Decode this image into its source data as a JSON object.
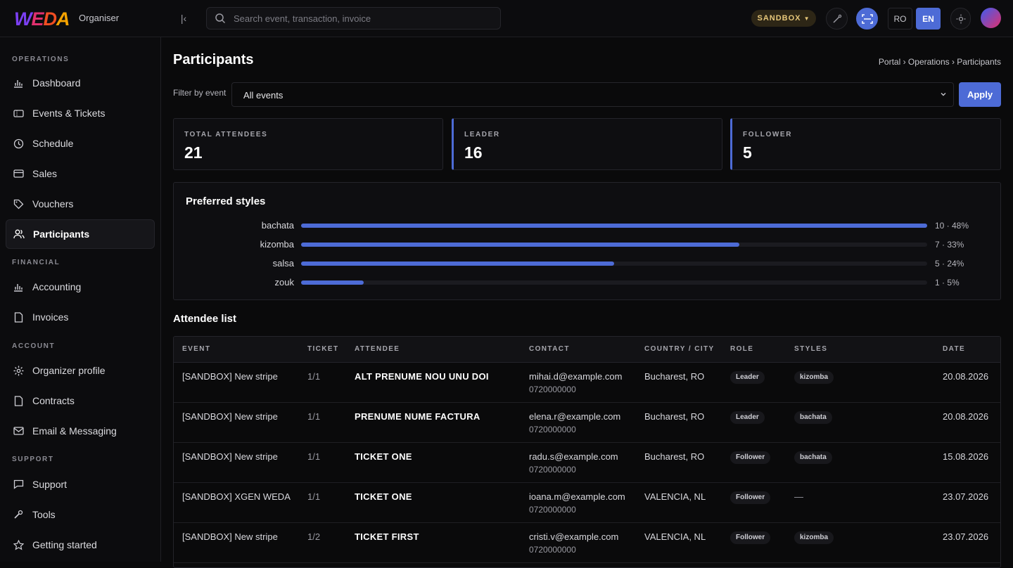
{
  "header": {
    "logo": [
      "W",
      "E",
      "D",
      "A"
    ],
    "org_label": "Organiser",
    "search_placeholder": "Search event, transaction, invoice",
    "sandbox_label": "SANDBOX",
    "lang_ro": "RO",
    "lang_en": "EN"
  },
  "sidebar": {
    "sections": [
      {
        "title": "OPERATIONS",
        "items": [
          {
            "label": "Dashboard",
            "icon": "chart-icon"
          },
          {
            "label": "Events & Tickets",
            "icon": "ticket-icon"
          },
          {
            "label": "Schedule",
            "icon": "clock-icon"
          },
          {
            "label": "Sales",
            "icon": "card-icon"
          },
          {
            "label": "Vouchers",
            "icon": "tag-icon"
          },
          {
            "label": "Participants",
            "icon": "users-icon",
            "active": true
          }
        ]
      },
      {
        "title": "FINANCIAL",
        "items": [
          {
            "label": "Accounting",
            "icon": "chart-icon"
          },
          {
            "label": "Invoices",
            "icon": "document-icon"
          }
        ]
      },
      {
        "title": "ACCOUNT",
        "items": [
          {
            "label": "Organizer profile",
            "icon": "gear-icon"
          },
          {
            "label": "Contracts",
            "icon": "document-icon"
          },
          {
            "label": "Email & Messaging",
            "icon": "mail-icon"
          }
        ]
      },
      {
        "title": "SUPPORT",
        "items": [
          {
            "label": "Support",
            "icon": "chat-icon"
          },
          {
            "label": "Tools",
            "icon": "wrench-icon"
          },
          {
            "label": "Getting started",
            "icon": "star-icon"
          }
        ]
      }
    ]
  },
  "page": {
    "title": "Participants",
    "breadcrumb": "Portal › Operations › Participants",
    "filter_label": "Filter by event",
    "filter_value": "All events",
    "apply_label": "Apply"
  },
  "stats": [
    {
      "label": "TOTAL ATTENDEES",
      "value": "21"
    },
    {
      "label": "LEADER",
      "value": "16"
    },
    {
      "label": "FOLLOWER",
      "value": "5"
    }
  ],
  "styles_panel": {
    "title": "Preferred styles",
    "items": [
      {
        "label": "bachata",
        "value_text": "10 · 48%",
        "fraction": 1.0
      },
      {
        "label": "kizomba",
        "value_text": "7 · 33%",
        "fraction": 0.7
      },
      {
        "label": "salsa",
        "value_text": "5 · 24%",
        "fraction": 0.5
      },
      {
        "label": "zouk",
        "value_text": "1 · 5%",
        "fraction": 0.1
      }
    ]
  },
  "attendees": {
    "title": "Attendee list",
    "columns": [
      "EVENT",
      "TICKET",
      "ATTENDEE",
      "CONTACT",
      "COUNTRY / CITY",
      "ROLE",
      "STYLES",
      "DATE"
    ],
    "rows": [
      {
        "event": "[SANDBOX] New stripe",
        "ticket": "1/1",
        "attendee": "ALT PRENUME NOU UNU DOI",
        "email": "mihai.d@example.com",
        "phone": "0720000000",
        "location": "Bucharest, RO",
        "role": "Leader",
        "styles": "kizomba",
        "date": "20.08.2026"
      },
      {
        "event": "[SANDBOX] New stripe",
        "ticket": "1/1",
        "attendee": "PRENUME NUME FACTURA",
        "email": "elena.r@example.com",
        "phone": "0720000000",
        "location": "Bucharest, RO",
        "role": "Leader",
        "styles": "bachata",
        "date": "20.08.2026"
      },
      {
        "event": "[SANDBOX] New stripe",
        "ticket": "1/1",
        "attendee": "TICKET ONE",
        "email": "radu.s@example.com",
        "phone": "0720000000",
        "location": "Bucharest, RO",
        "role": "Follower",
        "styles": "bachata",
        "date": "15.08.2026"
      },
      {
        "event": "[SANDBOX] XGEN WEDA",
        "ticket": "1/1",
        "attendee": "TICKET ONE",
        "email": "ioana.m@example.com",
        "phone": "0720000000",
        "location": "VALENCIA, NL",
        "role": "Follower",
        "styles": "—",
        "date": "23.07.2026"
      },
      {
        "event": "[SANDBOX] New stripe",
        "ticket": "1/2",
        "attendee": "TICKET FIRST",
        "email": "cristi.v@example.com",
        "phone": "0720000000",
        "location": "VALENCIA, NL",
        "role": "Follower",
        "styles": "kizomba",
        "date": "23.07.2026"
      }
    ]
  },
  "colors": {
    "accent": "#4d6bd6",
    "background": "#0a0a0b",
    "sandbox": "#e7c77a"
  }
}
